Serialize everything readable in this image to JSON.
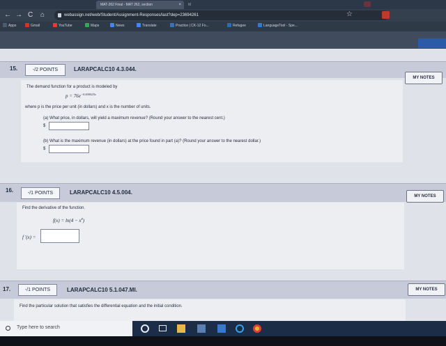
{
  "browser": {
    "tab_active": "MAT-262 Final - MAT 262, section",
    "tab_close": "×",
    "tab_second": "M",
    "url": "webassign.net/web/Student/Assignment-Responses/last?dep=23694261",
    "nav": {
      "back": "←",
      "forward": "→",
      "reload": "C",
      "home": "⌂"
    },
    "bookmarks": [
      {
        "label": "Apps",
        "color": "#4b5b72"
      },
      {
        "label": "Gmail",
        "color": "#d93025"
      },
      {
        "label": "YouTube",
        "color": "#e53935"
      },
      {
        "label": "Maps",
        "color": "#34a853"
      },
      {
        "label": "News",
        "color": "#4285f4"
      },
      {
        "label": "Translate",
        "color": "#4285f4"
      },
      {
        "label": "Practice | CK-12 Fo...",
        "color": "#3b6fb6"
      },
      {
        "label": "Refugee",
        "color": "#2b6cb0"
      },
      {
        "label": "LanguageTool - Spe...",
        "color": "#2e7bd6"
      }
    ]
  },
  "questions": [
    {
      "number": "15.",
      "points": "-/2 POINTS",
      "code": "LARAPCALC10 4.3.044.",
      "notes": "MY NOTES",
      "intro": "The demand function for a product is modeled by",
      "formula_lhs": "p = 76e",
      "formula_exp": "−0.000025x",
      "where": "where p is the price per unit (in dollars) and x is the number of units.",
      "part_a": "(a) What price, in dollars, will yield a maximum revenue? (Round your answer to the nearest cent.)",
      "part_b": "(b) What is the maximum revenue (in dollars) at the price found in part (a)? (Round your answer to the nearest dollar.)",
      "currency": "$"
    },
    {
      "number": "16.",
      "points": "-/1 POINTS",
      "code": "LARAPCALC10 4.5.004.",
      "notes": "MY NOTES",
      "intro": "Find the derivative of the function.",
      "formula_left": "f(x) = ln(4 − x",
      "formula_exp": "8",
      "formula_right": ")",
      "answer_label": "f ′(x) ="
    },
    {
      "number": "17.",
      "points": "-/1 POINTS",
      "code": "LARAPCALC10 5.1.047.MI.",
      "notes": "MY NOTES",
      "intro": "Find the particular solution that satisfies the differential equation and the initial condition."
    }
  ],
  "taskbar": {
    "search_placeholder": "Type here to search",
    "icons": [
      "cortana-icon",
      "task-view-icon",
      "file-explorer-icon",
      "store-icon",
      "mail-icon",
      "edge-icon",
      "chrome-icon"
    ]
  }
}
